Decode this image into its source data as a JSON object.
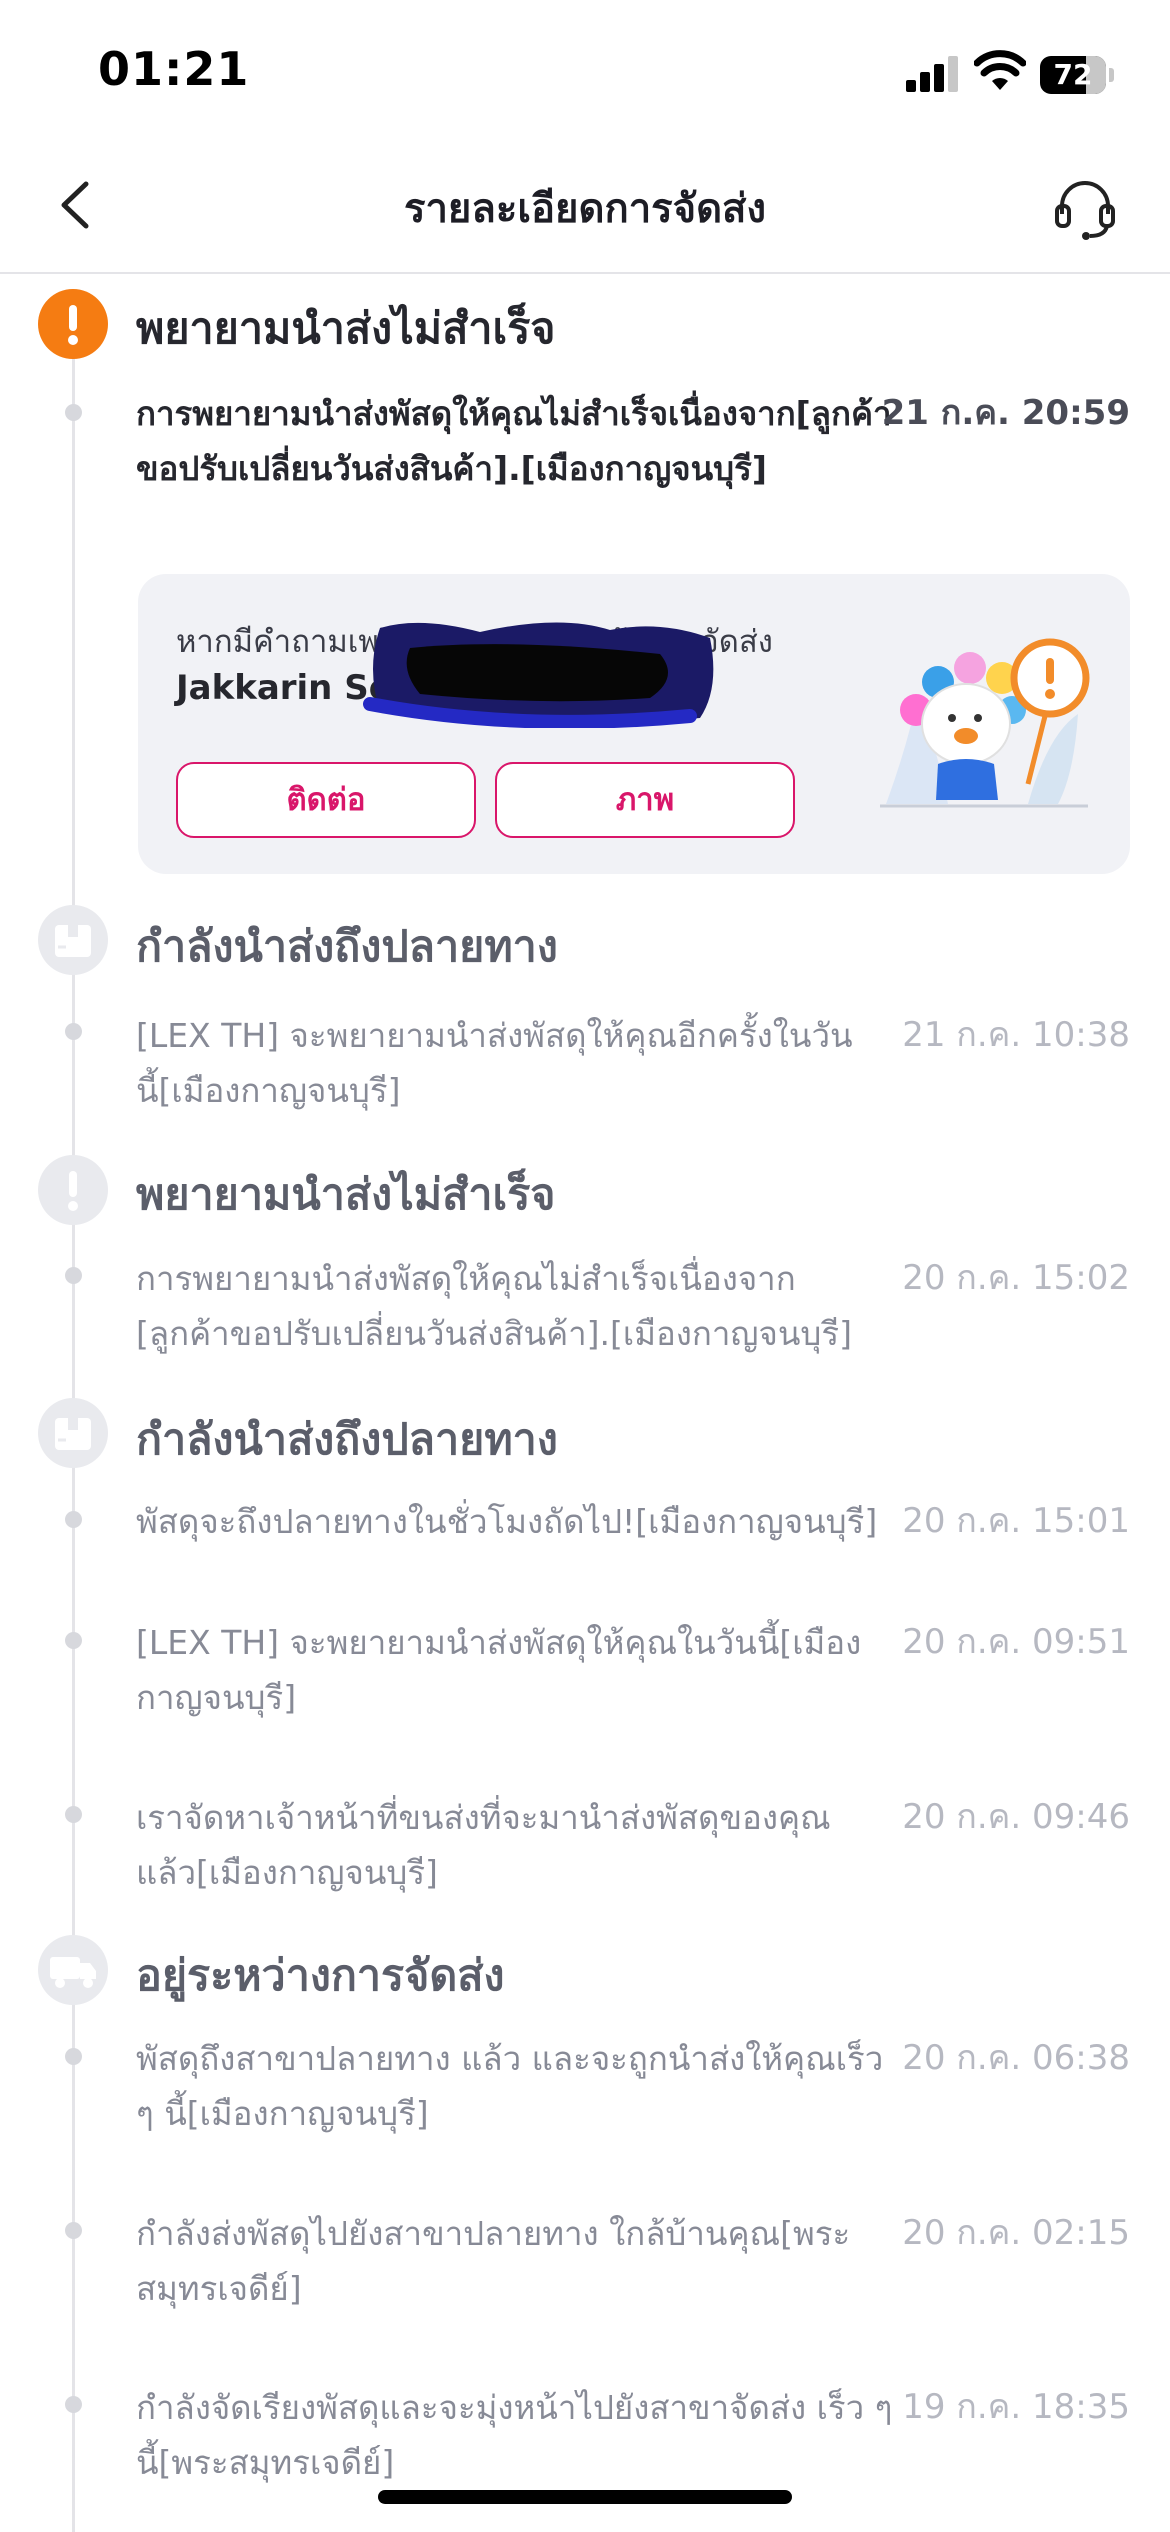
{
  "status_bar": {
    "time": "01:21",
    "battery": "72"
  },
  "header": {
    "title": "รายละเอียดการจัดส่ง"
  },
  "timeline": [
    {
      "status": "พยายามนำส่งไม่สำเร็จ",
      "active": true,
      "icon": "alert-icon",
      "events": [
        {
          "text": "การพยายามนำส่งพัสดุให้คุณไม่สำเร็จเนื่องจาก[ลูกค้าขอปรับเปลี่ยนวันส่งสินค้า].[เมืองกาญจนบุรี]",
          "time": "21 ก.ค. 20:59"
        }
      ]
    },
    {
      "status": "กำลังนำส่งถึงปลายทาง",
      "active": false,
      "icon": "parcel-icon",
      "events": [
        {
          "text": "[LEX TH] จะพยายามนำส่งพัสดุให้คุณอีกครั้งในวันนี้[เมืองกาญจนบุรี]",
          "time": "21 ก.ค. 10:38"
        }
      ]
    },
    {
      "status": "พยายามนำส่งไม่สำเร็จ",
      "active": false,
      "icon": "alert-icon",
      "events": [
        {
          "text": "การพยายามนำส่งพัสดุให้คุณไม่สำเร็จเนื่องจาก [ลูกค้าขอปรับเปลี่ยนวันส่งสินค้า].[เมืองกาญจนบุรี]",
          "time": "20 ก.ค. 15:02"
        }
      ]
    },
    {
      "status": "กำลังนำส่งถึงปลายทาง",
      "active": false,
      "icon": "parcel-icon",
      "events": [
        {
          "text": "พัสดุจะถึงปลายทางในชั่วโมงถัดไป![เมืองกาญจนบุรี]",
          "time": "20 ก.ค. 15:01"
        },
        {
          "text": "[LEX TH] จะพยายามนำส่งพัสดุให้คุณในวันนี้[เมืองกาญจนบุรี]",
          "time": "20 ก.ค. 09:51"
        },
        {
          "text": "เราจัดหาเจ้าหน้าที่ขนส่งที่จะมานำส่งพัสดุของคุณแล้ว[เมืองกาญจนบุรี]",
          "time": "20 ก.ค. 09:46"
        }
      ]
    },
    {
      "status": "อยู่ระหว่างการจัดส่ง",
      "active": false,
      "icon": "truck-icon",
      "events": [
        {
          "text": "พัสดุถึงสาขาปลายทาง แล้ว และจะถูกนำส่งให้คุณเร็ว ๆ นี้[เมืองกาญจนบุรี]",
          "time": "20 ก.ค. 06:38"
        },
        {
          "text": "กำลังส่งพัสดุไปยังสาขาปลายทาง ใกล้บ้านคุณ[พระสมุทรเจดีย์]",
          "time": "20 ก.ค. 02:15"
        },
        {
          "text": "กำลังจัดเรียงพัสดุและจะมุ่งหน้าไปยังสาขาจัดส่ง เร็ว ๆ นี้[พระสมุทรเจดีย์]",
          "time": "19 ก.ค. 18:35"
        }
      ]
    }
  ],
  "contact_card": {
    "question": "หากมีคำถามเพ",
    "question_end": "นักงานจัดส่ง",
    "courier_name": "Jakkarin So",
    "contact_button": "ติดต่อ",
    "photo_button": "ภาพ"
  },
  "colors": {
    "accent": "#d9166a",
    "alert": "#f57c12"
  }
}
